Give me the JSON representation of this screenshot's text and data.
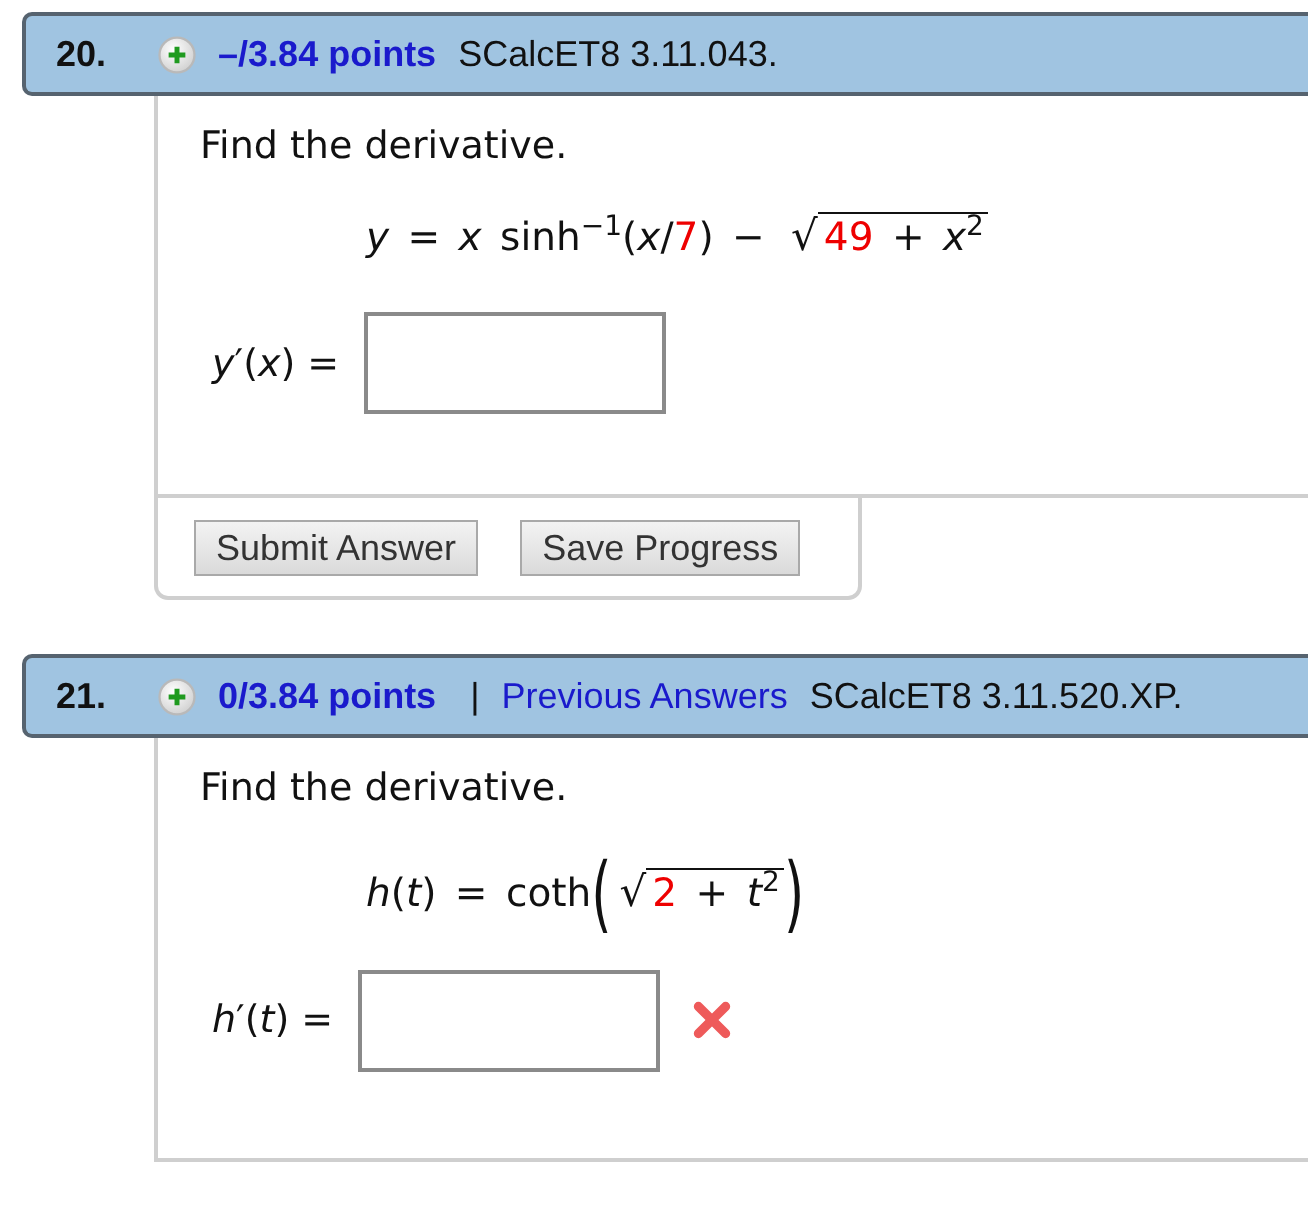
{
  "questions": [
    {
      "header": {
        "number": "20.",
        "points": "–/3.84 points",
        "source": "SCalcET8 3.11.043."
      },
      "prompt": "Find the derivative.",
      "formula": [
        {
          "kind": "math",
          "text": "*y* = *x* sinh$^{−1}$(*x*/"
        },
        {
          "kind": "given",
          "text": "7"
        },
        {
          "kind": "math",
          "text": ") − "
        },
        {
          "kind": "sqrt",
          "sign": "√",
          "children": [
            {
              "kind": "given",
              "text": "49"
            },
            {
              "kind": "math",
              "text": " + *x*$^{2}$"
            }
          ]
        }
      ],
      "answer": {
        "label": "*y*′(*x*) =",
        "incorrect": false
      },
      "buttons": [
        "Submit Answer",
        "Save Progress"
      ]
    },
    {
      "header": {
        "number": "21.",
        "points": "0/3.84 points",
        "separator": "|",
        "link": "Previous Answers",
        "source": "SCalcET8 3.11.520.XP."
      },
      "prompt": "Find the derivative.",
      "formula": [
        {
          "kind": "math",
          "text": "*h*(*t*) = coth"
        },
        {
          "kind": "paren",
          "text": "("
        },
        {
          "kind": "sqrt",
          "sign": "√",
          "children": [
            {
              "kind": "given",
              "text": "2"
            },
            {
              "kind": "math",
              "text": " + *t*$^{2}$"
            }
          ]
        },
        {
          "kind": "paren",
          "text": ")"
        }
      ],
      "answer": {
        "label": "*h*′(*t*) =",
        "incorrect": true
      }
    }
  ]
}
